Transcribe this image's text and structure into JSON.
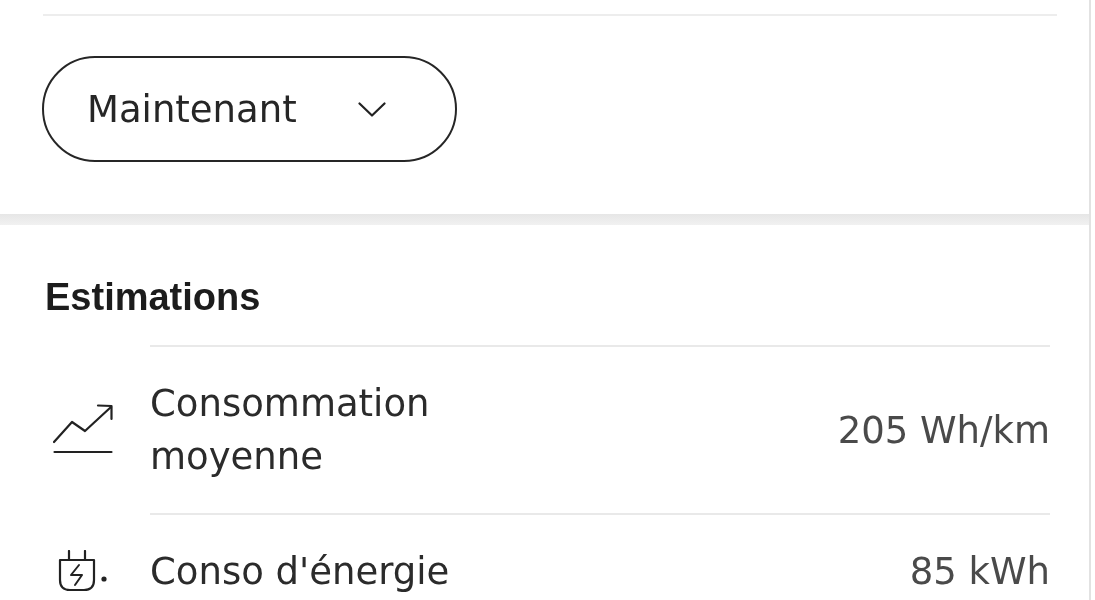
{
  "period_select": {
    "value": "Maintenant"
  },
  "estimations": {
    "title": "Estimations",
    "rows": [
      {
        "kind": "trend",
        "label": "Consommation moyenne",
        "value": "205 Wh/km"
      },
      {
        "kind": "plug",
        "label": "Conso d'énergie",
        "value": "85 kWh"
      }
    ]
  }
}
